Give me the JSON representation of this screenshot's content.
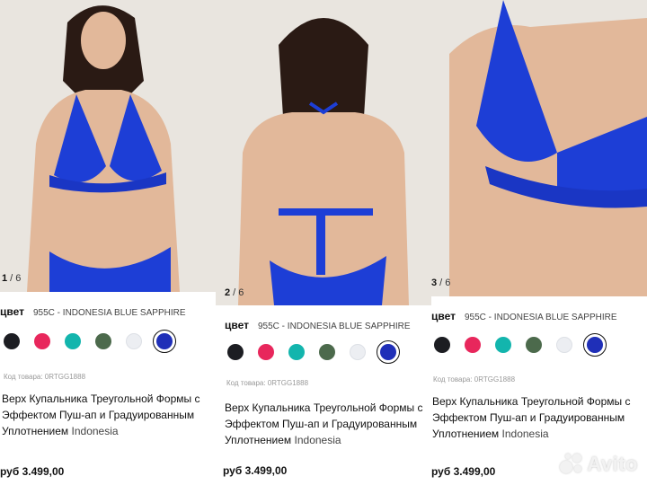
{
  "cards": [
    {
      "counter_current": "1",
      "counter_total": " / 6",
      "color_label": "цвет",
      "color_value": "955C - INDONESIA BLUE SAPPHIRE",
      "code": "Код товара: 0RTGG1888",
      "title": "Верх Купальника Треугольной Формы с Эффектом Пуш-ап и Градуированным Уплотнением",
      "country": "Indonesia",
      "price": "руб 3.499,00"
    },
    {
      "counter_current": "2",
      "counter_total": " / 6",
      "color_label": "цвет",
      "color_value": "955C - INDONESIA BLUE SAPPHIRE",
      "code": "Код товара: 0RTGG1888",
      "title": "Верх Купальника Треугольной Формы с Эффектом Пуш-ап и Градуированным Уплотнением",
      "country": "Indonesia",
      "price": "руб 3.499,00"
    },
    {
      "counter_current": "3",
      "counter_total": " / 6",
      "color_label": "цвет",
      "color_value": "955C - INDONESIA BLUE SAPPHIRE",
      "code": "Код товара: 0RTGG1888",
      "title": "Верх Купальника Треугольной Формы с Эффектом Пуш-ап и Градуированным Уплотнением",
      "country": "Indonesia",
      "price": "руб 3.499,00"
    }
  ],
  "swatches": [
    {
      "color": "#1c1d22",
      "name": "black"
    },
    {
      "color": "#e8275c",
      "name": "pink"
    },
    {
      "color": "#13b5ad",
      "name": "teal"
    },
    {
      "color": "#4c6a4c",
      "name": "green"
    },
    {
      "color": "#eceef2",
      "name": "white"
    },
    {
      "color": "#1f2fb8",
      "name": "blue-sapphire",
      "selected": true
    }
  ],
  "watermark": "Avito",
  "colors": {
    "swimsuit": "#1d3ed6",
    "skin": "#e2b89a",
    "background": "#e9e5df"
  }
}
